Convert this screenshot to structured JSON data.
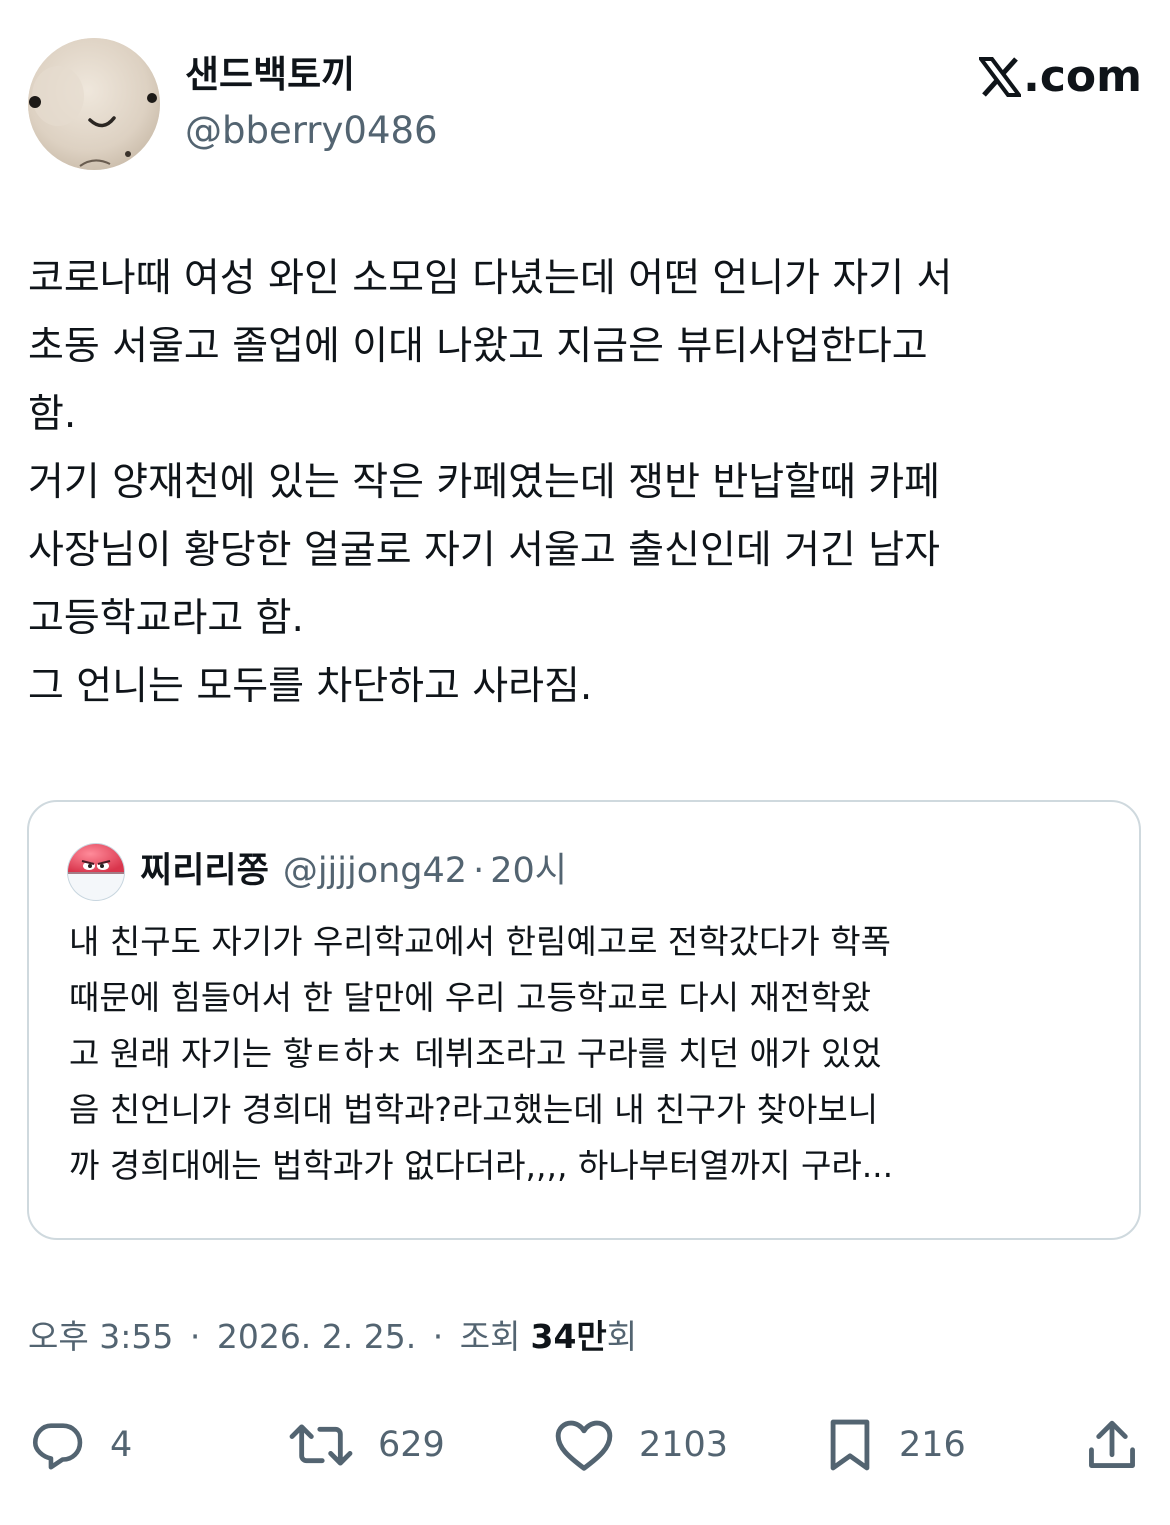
{
  "author": {
    "display_name": "샌드백토끼",
    "handle": "@bberry0486",
    "avatar_icon": "profile-photo-icon"
  },
  "brand": {
    "label": ".com",
    "icon": "x-logo-icon"
  },
  "tweet": {
    "lines": [
      "코로나때 여성 와인 소모임 다녔는데 어떤 언니가 자기 서",
      "초동 서울고 졸업에 이대 나왔고 지금은 뷰티사업한다고",
      "함.",
      "거기 양재천에 있는 작은 카페였는데 쟁반 반납할때 카페",
      "사장님이 황당한 얼굴로 자기 서울고 출신인데 거긴 남자",
      "고등학교라고 함.",
      "그 언니는 모두를 차단하고 사라짐."
    ]
  },
  "quote": {
    "avatar_icon": "pokemon-ball-avatar-icon",
    "display_name": "찌리리쫑",
    "handle": "@jjjjong42",
    "separator": "·",
    "time": "20시",
    "lines": [
      "내 친구도 자기가 우리학교에서 한림예고로 전학갔다가 학폭",
      "때문에 힘들어서 한 달만에 우리 고등학교로 다시 재전학왔",
      "고  원래 자기는 핳ㅌ하ㅊ 데뷔조라고 구라를 치던 애가 있었",
      "음 친언니가 경희대 법학과?라고했는데 내 친구가 찾아보니",
      "까 경희대에는 법학과가 없다더라,,,, 하나부터열까지 구라..."
    ]
  },
  "meta": {
    "time": "오후 3:55",
    "sep1": "·",
    "date": "2026. 2. 25.",
    "sep2": "·",
    "views_label": "조회",
    "views_count": "34만",
    "views_unit": "회"
  },
  "actions": {
    "reply": {
      "icon": "reply-icon",
      "count": "4"
    },
    "retweet": {
      "icon": "retweet-icon",
      "count": "629"
    },
    "like": {
      "icon": "heart-icon",
      "count": "2103"
    },
    "bookmark": {
      "icon": "bookmark-icon",
      "count": "216"
    },
    "share": {
      "icon": "share-icon"
    }
  },
  "colors": {
    "text": "#0f1419",
    "secondary": "#536471",
    "border": "#cfd9de",
    "background": "#ffffff"
  }
}
